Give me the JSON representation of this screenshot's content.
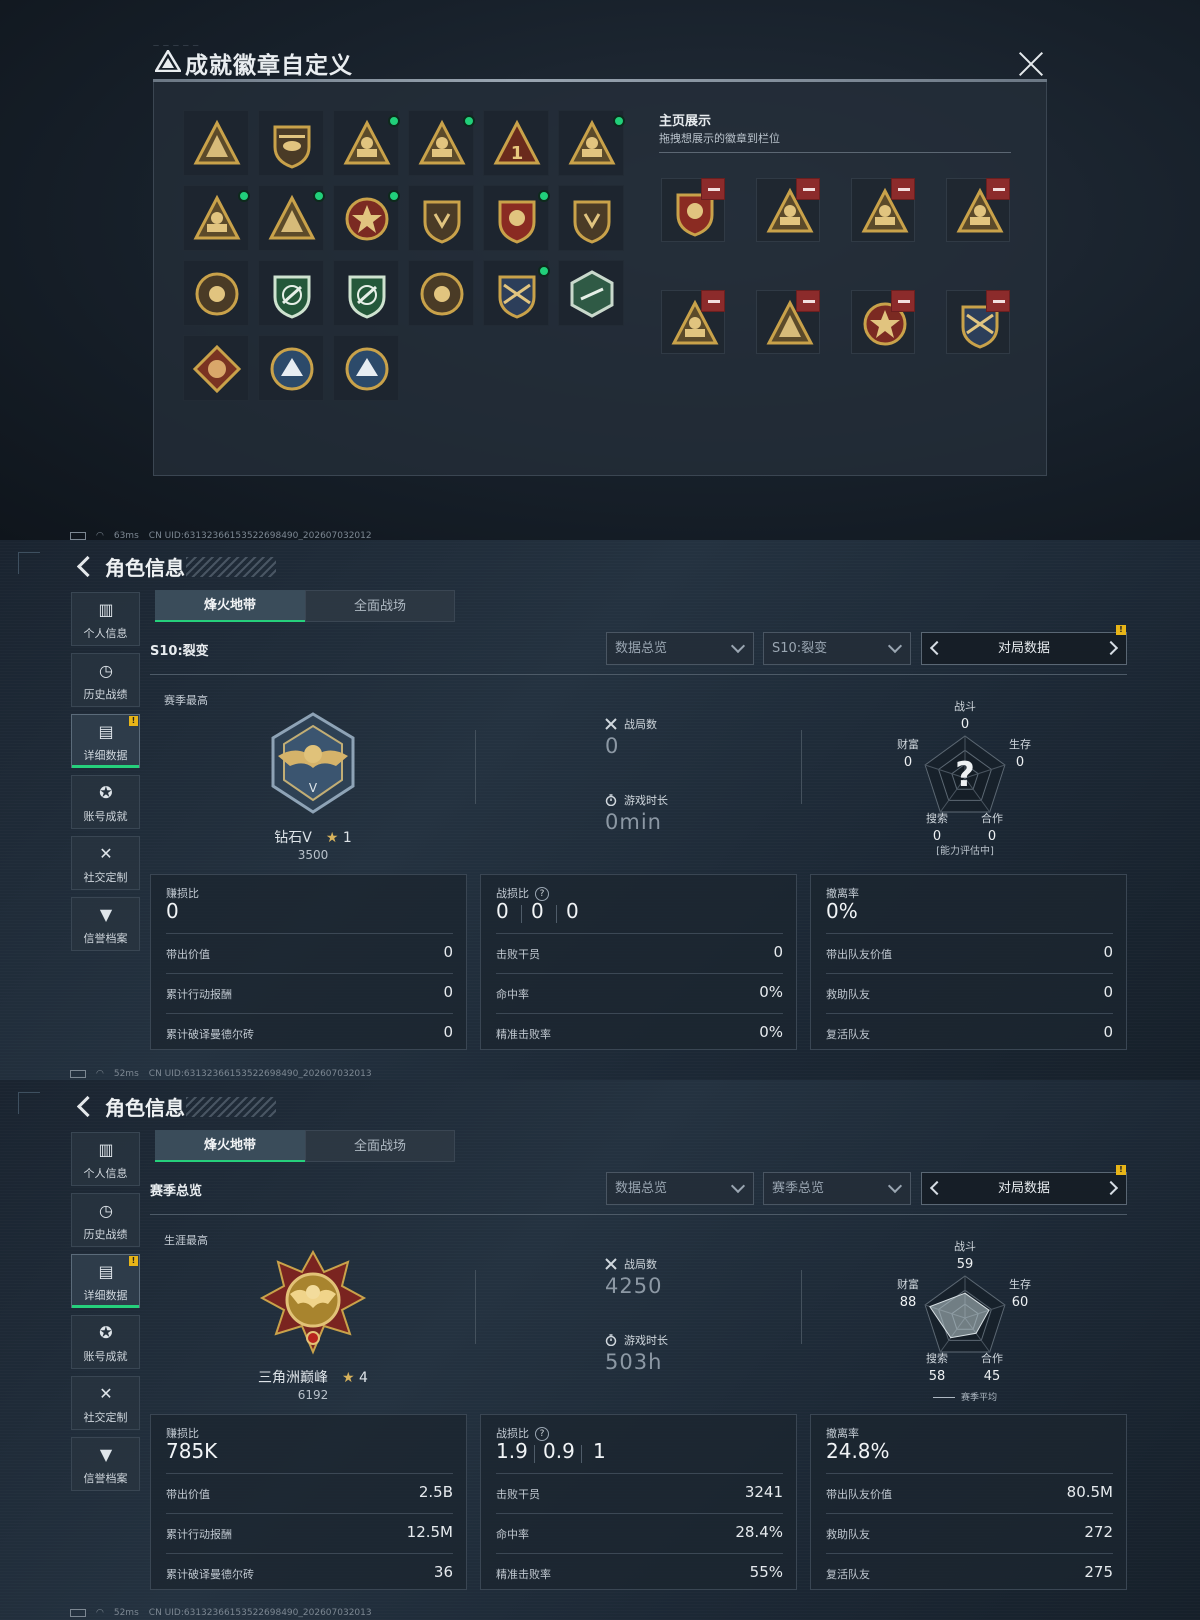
{
  "modal": {
    "title": "成就徽章自定义",
    "home_title": "主页展示",
    "home_subtitle": "拖拽想展示的徽章到栏位"
  },
  "status_bars": [
    {
      "ping": "63ms",
      "uid": "CN UID:6313236615352269849​0_202607032012"
    },
    {
      "ping": "52ms",
      "uid": "CN UID:63132366153522698490_202607032013"
    },
    {
      "ping": "52ms",
      "uid": "CN UID:63132366153522698490_202607032013"
    }
  ],
  "profile": {
    "title": "角色信息",
    "nav": [
      "个人信息",
      "历史战绩",
      "详细数据",
      "账号成就",
      "社交定制",
      "信誉档案"
    ],
    "tabs": [
      "烽火地带",
      "全面战场"
    ],
    "dropdown_1": "数据总览",
    "pager_label": "对局数据",
    "labels": {
      "matches": "战局数",
      "playtime": "游戏时长",
      "radar_combat": "战斗",
      "radar_survive": "生存",
      "radar_team": "合作",
      "radar_search": "搜索",
      "radar_wealth": "财富",
      "profit": "赚损比",
      "kd": "战损比",
      "extract": "撤离率",
      "carry_value": "带出价值",
      "action_reward": "累计行动报酬",
      "decode": "累计破译曼德尔砖",
      "kills": "击败干员",
      "accuracy": "命中率",
      "headshot": "精准击败率",
      "team_value": "带出队友价值",
      "rescue": "救助队友",
      "revive": "复活队友"
    }
  },
  "panel1": {
    "season_label": "S10:裂变",
    "dropdown_2": "S10:裂变",
    "best_label": "赛季最高",
    "rank_name": "钻石V",
    "rank_stars": "1",
    "rank_score": "3500",
    "matches": "0",
    "playtime": "0min",
    "radar": {
      "combat": "0",
      "survive": "0",
      "team": "0",
      "search": "0",
      "wealth": "0"
    },
    "radar_note": "[能力评估中]",
    "profit": "0",
    "kd": [
      "0",
      "0",
      "0"
    ],
    "extract": "0%",
    "carry_value": "0",
    "action_reward": "0",
    "decode": "0",
    "kills": "0",
    "accuracy": "0%",
    "headshot": "0%",
    "team_value": "0",
    "rescue": "0",
    "revive": "0"
  },
  "panel2": {
    "season_label": "赛季总览",
    "dropdown_2": "赛季总览",
    "best_label": "生涯最高",
    "rank_name": "三角洲巅峰",
    "rank_stars": "4",
    "rank_score": "6192",
    "matches": "4250",
    "playtime": "503h",
    "radar": {
      "combat": "59",
      "survive": "60",
      "team": "45",
      "search": "58",
      "wealth": "88"
    },
    "radar_legend": "赛季平均",
    "profit": "785K",
    "kd": [
      "1.9",
      "0.9",
      "1"
    ],
    "extract": "24.8%",
    "carry_value": "2.5B",
    "action_reward": "12.5M",
    "decode": "36",
    "kills": "3241",
    "accuracy": "28.4%",
    "headshot": "55%",
    "team_value": "80.5M",
    "rescue": "272",
    "revive": "275"
  },
  "colors": {
    "accent_green": "#26d07c",
    "warning": "#e8b518",
    "remove_red": "#8c2b2b",
    "badge_gold": "#c9a24a"
  }
}
